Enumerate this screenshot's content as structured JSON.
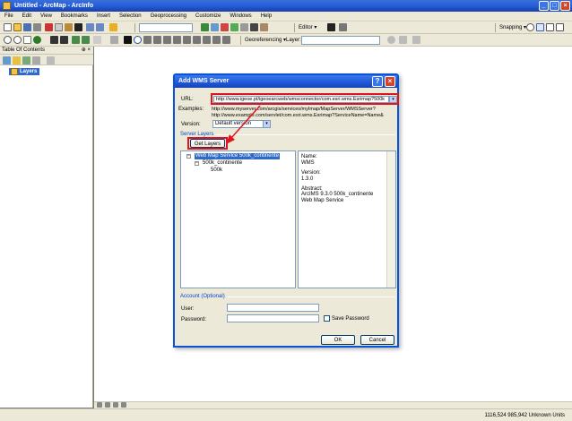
{
  "window": {
    "title": "Untitled - ArcMap - ArcInfo"
  },
  "menu": [
    "File",
    "Edit",
    "View",
    "Bookmarks",
    "Insert",
    "Selection",
    "Geoprocessing",
    "Customize",
    "Windows",
    "Help"
  ],
  "toolbar": {
    "editor_label": "Editor ▾",
    "snapping_label": "Snapping ▾",
    "georeferencing_label": "Georeferencing ▾",
    "layer_label": "Layer:"
  },
  "toc": {
    "title": "Table Of Contents",
    "pin": "⊕ ×",
    "root_layer": "Layers"
  },
  "status": {
    "coords": "1116,524  985,942 Unknown Units"
  },
  "dialog": {
    "title": "Add WMS Server",
    "help_icon": "?",
    "close_icon": "×",
    "url_label": "URL:",
    "url_value": "http://www.igeoe.pt/igeoearcweb/wmsconnector/com.esri.wms.Esrimap?500k",
    "examples_label": "Examples:",
    "example_1": "http://www.myserver.com/arcgis/services/myImap/MapServer/WMSServer?",
    "example_2": "http://www.example.com/servlet/com.esri.wms.Esrimap?ServiceName=Name&",
    "version_label": "Version:",
    "version_value": "Default version",
    "server_layers_label": "Server Layers",
    "get_layers_button": "Get Layers",
    "tree": {
      "root": "Web Map Service 500k_continente",
      "child": "500k_continente",
      "grandchild": "500k"
    },
    "info": {
      "name_label": "Name:",
      "name_value": "WMS",
      "version_label": "Version:",
      "version_value": "1.3.0",
      "abstract_label": "Abstract:",
      "abstract_value": "ArcIMS 9.3.0 500k_continente Web Map Service"
    },
    "account_label": "Account (Optional)",
    "user_label": "User:",
    "password_label": "Password:",
    "save_password_label": "Save Password",
    "ok_button": "OK",
    "cancel_button": "Cancel"
  }
}
